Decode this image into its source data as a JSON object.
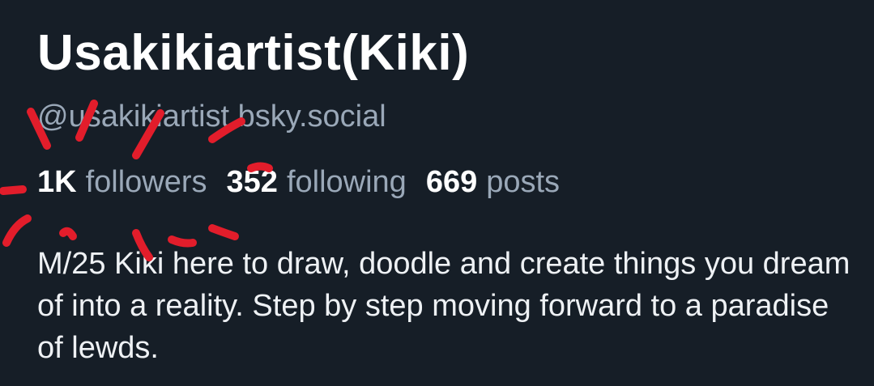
{
  "profile": {
    "display_name": "Usakikiartist(Kiki)",
    "handle": "@usakikiartist.bsky.social",
    "stats": {
      "followers_count": "1K",
      "followers_label": "followers",
      "following_count": "352",
      "following_label": "following",
      "posts_count": "669",
      "posts_label": "posts"
    },
    "bio": "M/25 Kiki here to draw, doodle and create things you dream of into a reality. Step by step moving forward to a paradise of lewds."
  },
  "annotation": {
    "color": "#e21d2b"
  }
}
